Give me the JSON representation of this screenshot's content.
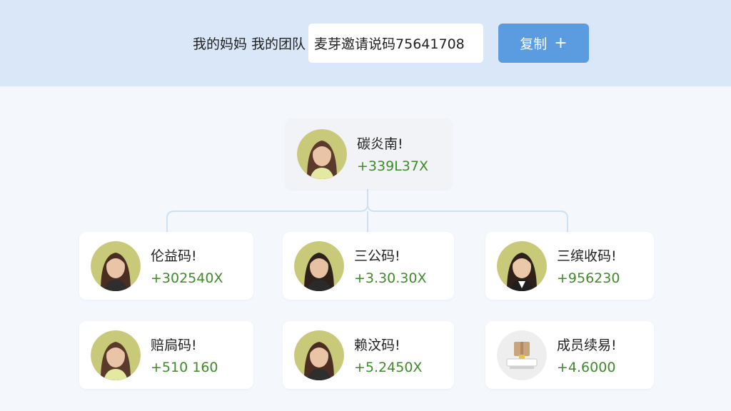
{
  "header": {
    "title": "我的妈妈 我的团队",
    "invite_text": "麦芽邀请说码75641708",
    "copy_label": "复制",
    "copy_icon": "plus-icon"
  },
  "root": {
    "name": "碳炎南!",
    "value": "+339L37X"
  },
  "members": [
    {
      "name": "伦益码!",
      "value": "+302540X",
      "avatar": "woman"
    },
    {
      "name": "三公码!",
      "value": "+3.30.30X",
      "avatar": "woman"
    },
    {
      "name": "三缤收码!",
      "value": "+956230",
      "avatar": "woman"
    },
    {
      "name": "赔扃码!",
      "value": "+510 160",
      "avatar": "woman"
    },
    {
      "name": "赖汶码!",
      "value": "+5.2450X",
      "avatar": "woman"
    },
    {
      "name": "成员续易!",
      "value": "+4.6000",
      "avatar": "box-icon"
    }
  ],
  "colors": {
    "header_bg": "#d9e7f8",
    "accent": "#5b9be0",
    "value_green": "#3f8a2a",
    "avatar_bg": "#c9c97a"
  }
}
